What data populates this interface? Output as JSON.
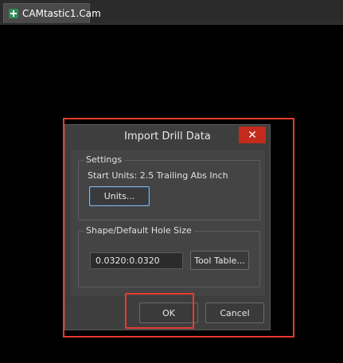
{
  "tab": {
    "title": "CAMtastic1.Cam",
    "icon": "cam-document-icon"
  },
  "dialog": {
    "title": "Import Drill Data",
    "close_label": "✕",
    "settings": {
      "group_title": "Settings",
      "start_units": "Start Units: 2.5 Trailing Abs Inch",
      "units_button": "Units..."
    },
    "shape": {
      "group_title": "Shape/Default Hole Size",
      "hole_size_value": "0.0320:0.0320",
      "tool_table_button": "Tool Table..."
    },
    "ok_label": "OK",
    "cancel_label": "Cancel"
  },
  "colors": {
    "background": "#000000",
    "dialog_bg": "#3e3e3e",
    "close_button": "#c42b1c",
    "highlight": "#e63b2e"
  }
}
